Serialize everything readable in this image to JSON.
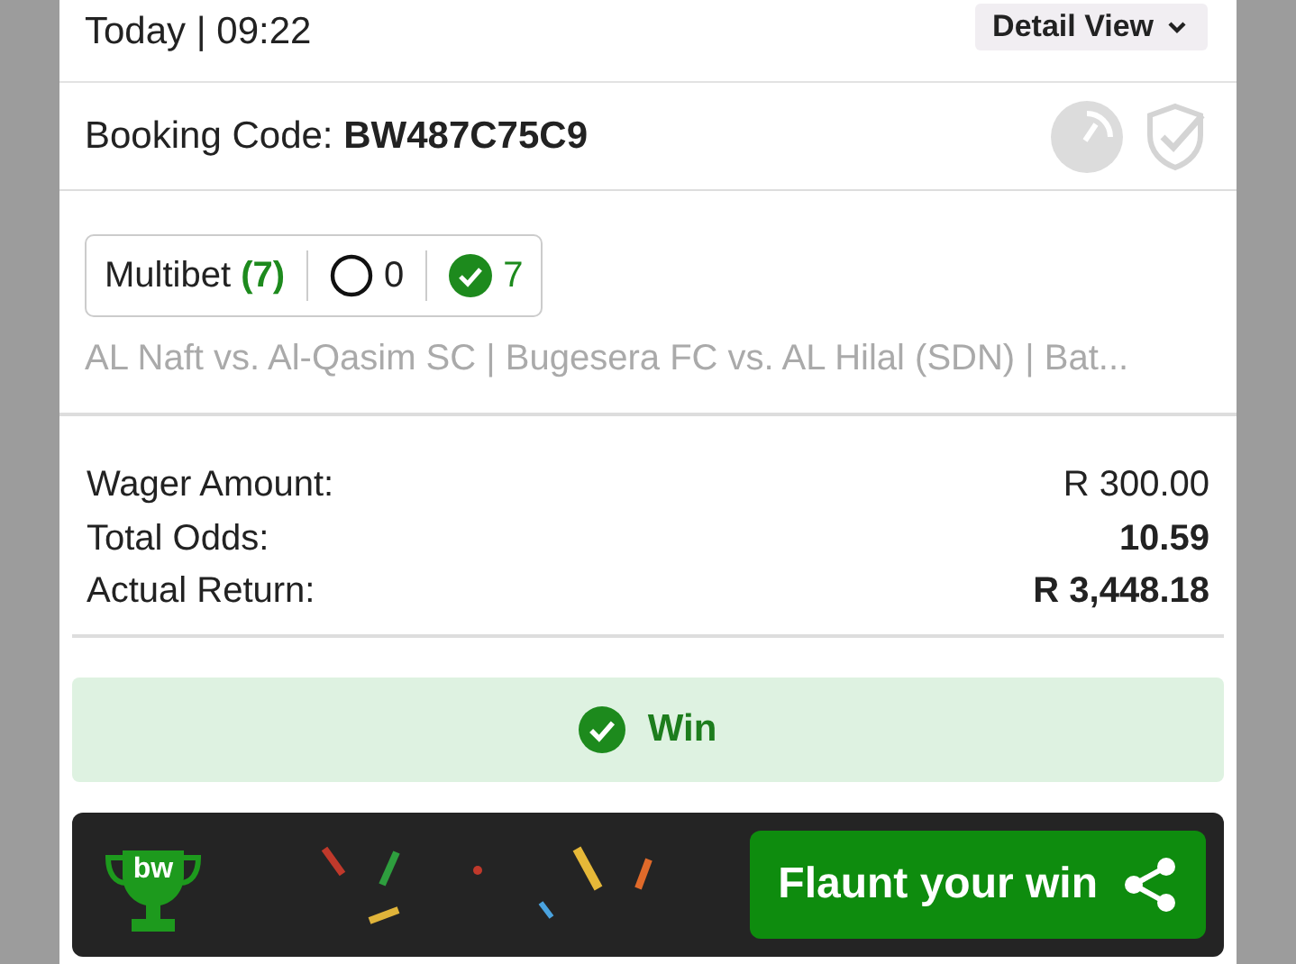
{
  "header": {
    "date_time": "Today | 09:22",
    "view_button": "Detail View"
  },
  "booking": {
    "label": "Booking Code:",
    "code": "BW487C75C9"
  },
  "bet": {
    "type": "Multibet",
    "count": "(7)",
    "open_count": "0",
    "won_count": "7",
    "events": "AL Naft vs. Al-Qasim SC | Bugesera FC vs. AL Hilal (SDN) | Bat..."
  },
  "summary": [
    {
      "label": "Wager Amount:",
      "value": "R 300.00",
      "bold": false
    },
    {
      "label": "Total Odds:",
      "value": "10.59",
      "bold": true
    },
    {
      "label": "Actual Return:",
      "value": "R 3,448.18",
      "bold": true
    }
  ],
  "result": {
    "status": "Win"
  },
  "promo": {
    "logo_text": "bw",
    "button": "Flaunt your win"
  }
}
